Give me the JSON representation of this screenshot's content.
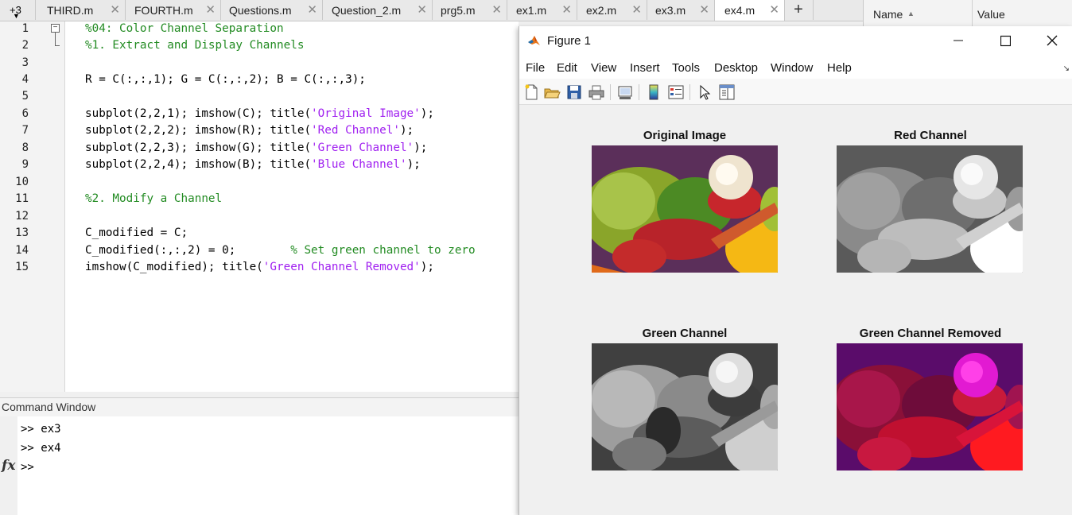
{
  "editor": {
    "tabs": [
      {
        "label": "THIRD.m"
      },
      {
        "label": "FOURTH.m"
      },
      {
        "label": "Questions.m"
      },
      {
        "label": "Question_2.m"
      },
      {
        "label": "prg5.m"
      },
      {
        "label": "ex1.m"
      },
      {
        "label": "ex2.m"
      },
      {
        "label": "ex3.m"
      },
      {
        "label": "ex4.m",
        "active": true
      }
    ],
    "overflow_label": "+3",
    "add_tab": "+",
    "close_glyph": "✕",
    "line_numbers": [
      "1",
      "2",
      "3",
      "4",
      "5",
      "6",
      "7",
      "8",
      "9",
      "10",
      "11",
      "12",
      "13",
      "14",
      "15"
    ],
    "code": {
      "l1": "%04: Color Channel Separation",
      "l2": "%1. Extract and Display Channels",
      "l4": "R = C(:,:,1); G = C(:,:,2); B = C(:,:,3);",
      "l6a": "subplot(2,2,1); imshow(C); title(",
      "l6s": "'Original Image'",
      "l6b": ");",
      "l7a": "subplot(2,2,2); imshow(R); title(",
      "l7s": "'Red Channel'",
      "l7b": ");",
      "l8a": "subplot(2,2,3); imshow(G); title(",
      "l8s": "'Green Channel'",
      "l8b": ");",
      "l9a": "subplot(2,2,4); imshow(B); title(",
      "l9s": "'Blue Channel'",
      "l9b": ");",
      "l11": "%2. Modify a Channel",
      "l13": "C_modified = C;",
      "l14a": "C_modified(:,:,2) = 0;        ",
      "l14c": "% Set green channel to zero",
      "l15a": "imshow(C_modified); title(",
      "l15s": "'Green Channel Removed'",
      "l15b": ");"
    }
  },
  "command_window": {
    "title": "Command Window",
    "lines": [
      ">> ex3",
      ">> ex4",
      ">> "
    ],
    "fx_label": "fx"
  },
  "workspace": {
    "name_header": "Name",
    "value_header": "Value"
  },
  "figure": {
    "title": "Figure 1",
    "menu": [
      "File",
      "Edit",
      "View",
      "Insert",
      "Tools",
      "Desktop",
      "Window",
      "Help"
    ],
    "toolbar_icons": [
      "new-figure-icon",
      "open-file-icon",
      "save-icon",
      "print-icon",
      "link-plot-icon",
      "insert-colorbar-icon",
      "insert-legend-icon",
      "edit-plot-icon",
      "property-inspector-icon"
    ],
    "panels": [
      {
        "title": "Original Image"
      },
      {
        "title": "Red Channel"
      },
      {
        "title": "Green Channel"
      },
      {
        "title": "Green Channel Removed"
      }
    ]
  },
  "colors": {
    "comment": "#228b22",
    "string": "#a020f0"
  }
}
